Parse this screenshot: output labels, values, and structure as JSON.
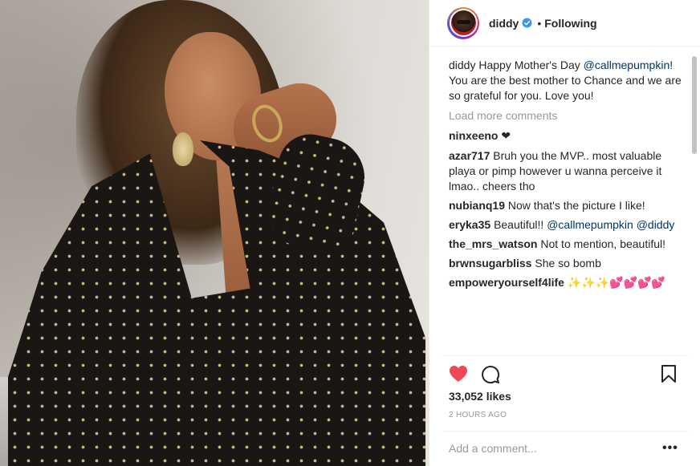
{
  "post": {
    "author": "diddy",
    "follow_status": "Following",
    "separator": "•",
    "caption": {
      "user": "diddy",
      "text_before": "Happy Mother's Day ",
      "mention": "@callmepumpkin",
      "text_after": "! You are the best mother to Chance and we are so grateful for you. Love you!"
    },
    "load_more": "Load more comments",
    "comments": [
      {
        "user": "ninxeeno",
        "text": "❤"
      },
      {
        "user": "azar717",
        "text": "Bruh you the MVP.. most valuable playa or pimp however u wanna perceive it lmao.. cheers tho"
      },
      {
        "user": "nubianq19",
        "text": "Now that's the picture I like!"
      },
      {
        "user": "eryka35",
        "text_before": "Beautiful!! ",
        "mention1": "@callmepumpkin",
        "mention2": "@diddy"
      },
      {
        "user": "the_mrs_watson",
        "text": "Not to mention, beautiful!"
      },
      {
        "user": "brwnsugarbliss",
        "text": "She so bomb"
      },
      {
        "user": "empoweryourself4life",
        "sparkles": "✨✨✨",
        "hearts": "💕💕💕💕"
      }
    ],
    "likes": "33,052 likes",
    "time_ago": "2 HOURS AGO",
    "add_comment_placeholder": "Add a comment...",
    "more_options": "•••"
  },
  "colors": {
    "like_red": "#ed4956",
    "verified_blue": "#3897f0",
    "mention_blue": "#003569",
    "muted_gray": "#999999"
  },
  "icons": [
    "heart-icon",
    "comment-icon",
    "bookmark-icon",
    "verified-badge-icon",
    "more-options-icon"
  ]
}
